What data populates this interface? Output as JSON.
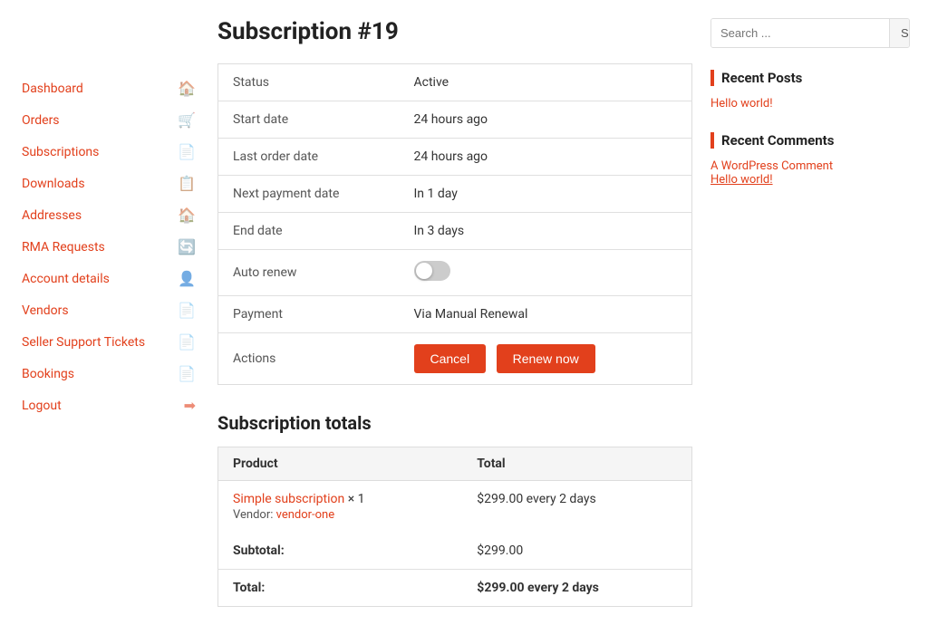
{
  "page": {
    "title": "Subscription #19"
  },
  "sidebar": {
    "items": [
      {
        "label": "Dashboard",
        "icon": "🏠",
        "id": "dashboard"
      },
      {
        "label": "Orders",
        "icon": "🛒",
        "id": "orders"
      },
      {
        "label": "Subscriptions",
        "icon": "📄",
        "id": "subscriptions"
      },
      {
        "label": "Downloads",
        "icon": "📋",
        "id": "downloads"
      },
      {
        "label": "Addresses",
        "icon": "🏠",
        "id": "addresses"
      },
      {
        "label": "RMA Requests",
        "icon": "🔄",
        "id": "rma-requests"
      },
      {
        "label": "Account details",
        "icon": "👤",
        "id": "account-details"
      },
      {
        "label": "Vendors",
        "icon": "📄",
        "id": "vendors"
      },
      {
        "label": "Seller Support Tickets",
        "icon": "📄",
        "id": "seller-support-tickets"
      },
      {
        "label": "Bookings",
        "icon": "📄",
        "id": "bookings"
      },
      {
        "label": "Logout",
        "icon": "➡",
        "id": "logout"
      }
    ]
  },
  "subscription": {
    "fields": [
      {
        "label": "Status",
        "value": "Active"
      },
      {
        "label": "Start date",
        "value": "24 hours ago"
      },
      {
        "label": "Last order date",
        "value": "24 hours ago"
      },
      {
        "label": "Next payment date",
        "value": "In 1 day"
      },
      {
        "label": "End date",
        "value": "In 3 days"
      },
      {
        "label": "Auto renew",
        "value": "toggle"
      },
      {
        "label": "Payment",
        "value": "Via Manual Renewal"
      },
      {
        "label": "Actions",
        "value": "actions"
      }
    ],
    "cancel_button": "Cancel",
    "renew_button": "Renew now"
  },
  "totals": {
    "section_title": "Subscription totals",
    "columns": [
      "Product",
      "Total"
    ],
    "rows": [
      {
        "product_link": "Simple subscription",
        "product_qty": "× 1",
        "vendor_label": "Vendor:",
        "vendor_link": "vendor-one",
        "total": "$299.00 every 2 days"
      }
    ],
    "subtotal_label": "Subtotal:",
    "subtotal_value": "$299.00",
    "total_label": "Total:",
    "total_value": "$299.00 every 2 days"
  },
  "right_sidebar": {
    "search_placeholder": "Search ...",
    "search_button_label": "Sea",
    "recent_posts_title": "Recent Posts",
    "recent_posts": [
      {
        "label": "Hello world!"
      }
    ],
    "recent_comments_title": "Recent Comments",
    "recent_comment_text": "A WordPress Comment",
    "recent_comment_link": "Hello world!"
  }
}
